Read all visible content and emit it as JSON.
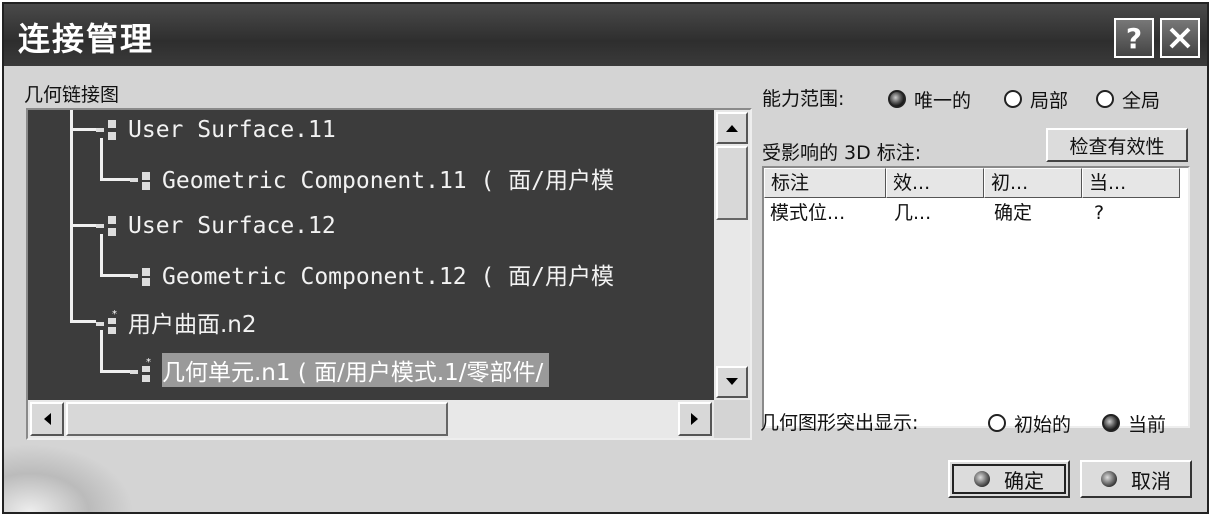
{
  "window": {
    "title": "连接管理",
    "help": "?",
    "close": "✕"
  },
  "tree": {
    "label": "几何链接图",
    "rows": [
      {
        "text": "User Surface.11",
        "level": 0,
        "selected": false
      },
      {
        "text": "Geometric Component.11 ( 面/用户模",
        "level": 1,
        "selected": false
      },
      {
        "text": "User Surface.12",
        "level": 0,
        "selected": false
      },
      {
        "text": "Geometric Component.12 ( 面/用户模",
        "level": 1,
        "selected": false
      },
      {
        "text": "用户曲面.n2",
        "level": 0,
        "selected": false
      },
      {
        "text": "几何单元.n1 ( 面/用户模式.1/零部件/",
        "level": 1,
        "selected": true
      }
    ]
  },
  "scope": {
    "label": "能力范围:",
    "options": [
      "唯一的",
      "局部",
      "全局"
    ],
    "selected": "唯一的"
  },
  "annotations": {
    "label": "受影响的 3D 标注:",
    "check_button": "检查有效性",
    "columns": [
      "标注",
      "效...",
      "初...",
      "当..."
    ],
    "rows": [
      [
        "模式位...",
        "几...",
        "确定",
        "?"
      ]
    ]
  },
  "highlight": {
    "label": "几何图形突出显示:",
    "options": [
      "初始的",
      "当前"
    ],
    "selected": "当前"
  },
  "buttons": {
    "ok": "确定",
    "cancel": "取消"
  }
}
